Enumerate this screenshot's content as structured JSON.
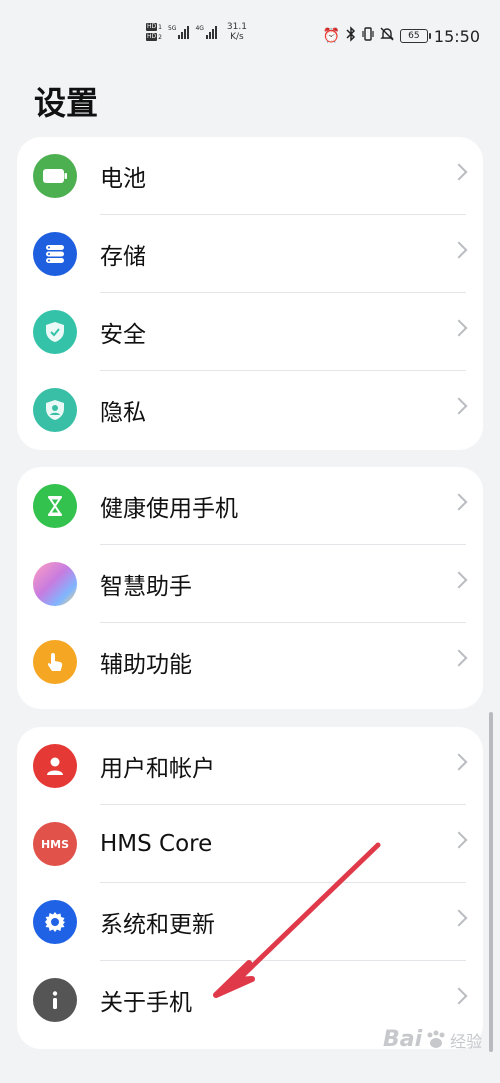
{
  "status_bar": {
    "hd1": "HD",
    "hd1_sim": "1",
    "hd2": "HD",
    "hd2_sim": "2",
    "net1": "5G",
    "net2": "4G",
    "speed_value": "31.1",
    "speed_unit": "K/s",
    "battery": "65",
    "time": "15:50"
  },
  "page": {
    "title": "设置"
  },
  "groups": [
    {
      "items": [
        {
          "label": "电池",
          "color": "#4caf50"
        },
        {
          "label": "存储",
          "color": "#1e5fe0"
        },
        {
          "label": "安全",
          "color": "#34c3a8"
        },
        {
          "label": "隐私",
          "color": "#38bfa6"
        }
      ]
    },
    {
      "items": [
        {
          "label": "健康使用手机",
          "color": "#33c24d"
        },
        {
          "label": "智慧助手",
          "color": "#c77ce0"
        },
        {
          "label": "辅助功能",
          "color": "#f5a623"
        }
      ]
    },
    {
      "items": [
        {
          "label": "用户和帐户",
          "color": "#e53935"
        },
        {
          "label": "HMS Core",
          "color": "#e0524a",
          "badge": "HMS"
        },
        {
          "label": "系统和更新",
          "color": "#1f62e6"
        },
        {
          "label": "关于手机",
          "color": "#555555"
        }
      ]
    }
  ],
  "watermark": {
    "brand": "Bai",
    "sub": "经验"
  },
  "icons": {
    "battery": "battery-icon",
    "storage": "storage-icon",
    "security": "shield-icon",
    "privacy": "privacy-shield-icon",
    "health": "hourglass-icon",
    "assistant": "orb-icon",
    "accessibility": "hand-icon",
    "users": "person-icon",
    "system": "gear-icon",
    "about": "info-icon"
  }
}
